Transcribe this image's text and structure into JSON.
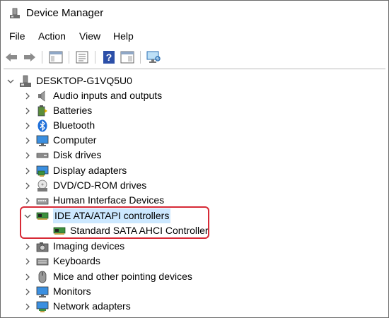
{
  "window": {
    "title": "Device Manager",
    "icon": "device-manager-icon"
  },
  "menu": [
    "File",
    "Action",
    "View",
    "Help"
  ],
  "toolbar": {
    "buttons": [
      "back-arrow-icon",
      "forward-arrow-icon",
      "show-hide-tree-icon",
      "properties-icon",
      "help-icon",
      "view-pane-icon",
      "monitor-scan-icon"
    ]
  },
  "tree": {
    "root": {
      "label": "DESKTOP-G1VQ5U0",
      "icon": "computer-icon",
      "expanded": true
    },
    "items": [
      {
        "label": "Audio inputs and outputs",
        "icon": "speaker-icon",
        "expanded": false
      },
      {
        "label": "Batteries",
        "icon": "battery-icon",
        "expanded": false
      },
      {
        "label": "Bluetooth",
        "icon": "bluetooth-icon",
        "expanded": false
      },
      {
        "label": "Computer",
        "icon": "monitor-icon",
        "expanded": false
      },
      {
        "label": "Disk drives",
        "icon": "disk-drive-icon",
        "expanded": false
      },
      {
        "label": "Display adapters",
        "icon": "display-adapter-icon",
        "expanded": false
      },
      {
        "label": "DVD/CD-ROM drives",
        "icon": "dvd-drive-icon",
        "expanded": false
      },
      {
        "label": "Human Interface Devices",
        "icon": "hid-icon",
        "expanded": false
      },
      {
        "label": "IDE ATA/ATAPI controllers",
        "icon": "ide-controller-icon",
        "expanded": true,
        "selected": true
      },
      {
        "label": "Standard SATA AHCI Controller",
        "icon": "ide-controller-icon",
        "child": true
      },
      {
        "label": "Imaging devices",
        "icon": "camera-icon",
        "expanded": false
      },
      {
        "label": "Keyboards",
        "icon": "keyboard-icon",
        "expanded": false
      },
      {
        "label": "Mice and other pointing devices",
        "icon": "mouse-icon",
        "expanded": false
      },
      {
        "label": "Monitors",
        "icon": "monitor-icon",
        "expanded": false
      },
      {
        "label": "Network adapters",
        "icon": "network-adapter-icon",
        "expanded": false
      }
    ]
  },
  "colors": {
    "highlight_border": "#d72a36",
    "selection_bg": "#cce8ff",
    "bluetooth_blue": "#1e6fd9"
  }
}
